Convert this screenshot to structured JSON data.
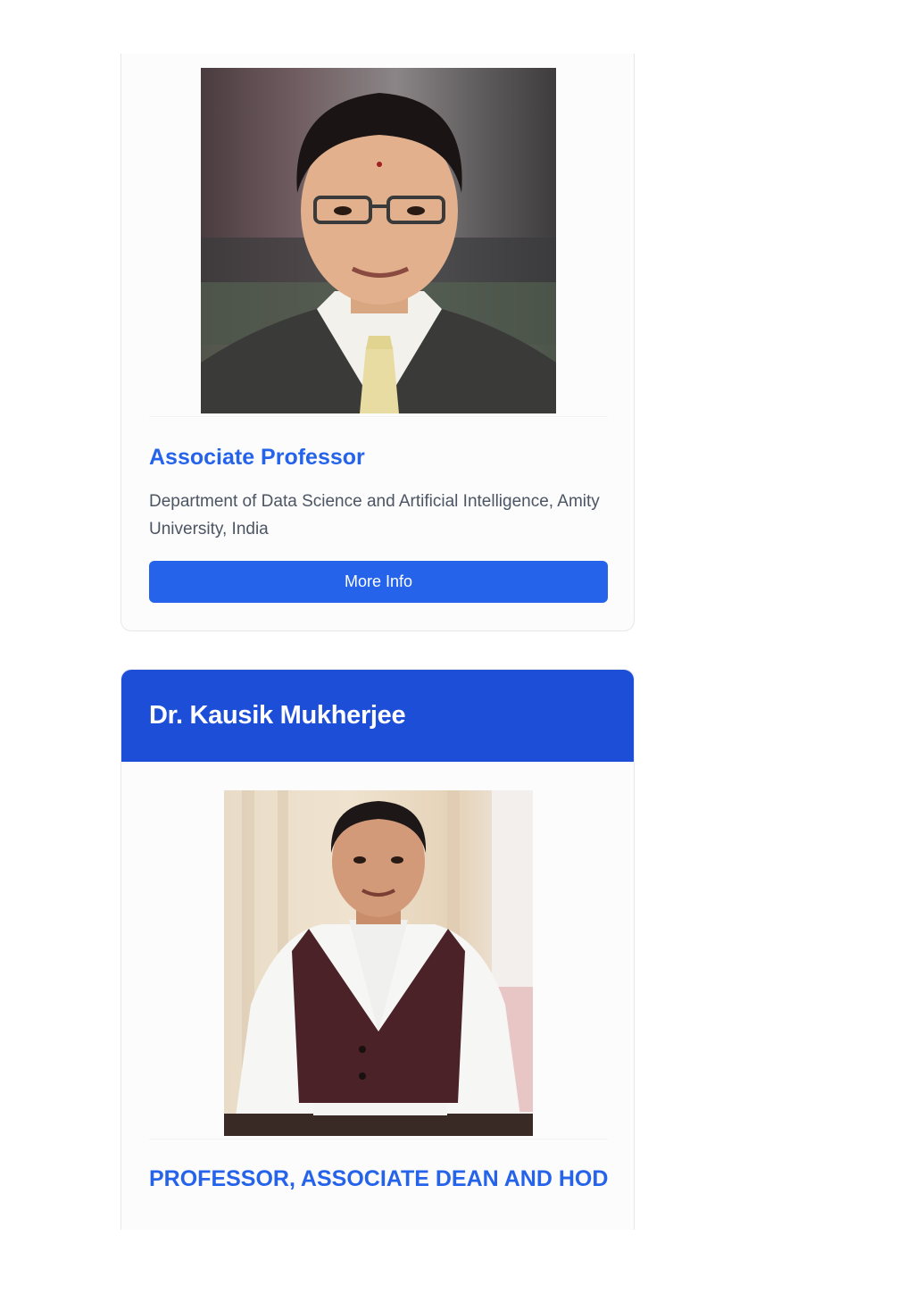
{
  "cards": [
    {
      "role": "Associate Professor",
      "department": "Department of Data Science and Artificial Intelligence, Amity University, India",
      "button_label": "More Info"
    },
    {
      "name": "Dr. Kausik Mukherjee",
      "role": "PROFESSOR, ASSOCIATE DEAN AND HOD"
    }
  ],
  "colors": {
    "accent": "#2563eb",
    "header": "#1d4ed8",
    "body_text": "#4b5563"
  }
}
